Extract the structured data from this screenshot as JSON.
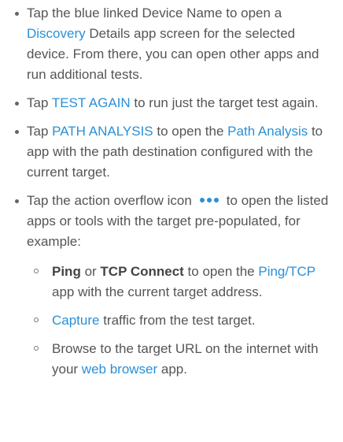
{
  "colors": {
    "link": "#2a8fd8",
    "text": "#555555"
  },
  "items": [
    {
      "pre": "Tap the blue linked Device Name to open a ",
      "link": "Discovery",
      "post": " Details app screen for the selected device. From there, you can open other apps and run additional tests."
    },
    {
      "pre": "Tap ",
      "link": "TEST AGAIN",
      "post": " to run just the target test again."
    },
    {
      "pre": "Tap ",
      "link": "PATH ANALYSIS",
      "mid": " to open the ",
      "link2": "Path Analysis",
      "post": " to app with the path destination configured with the current target."
    },
    {
      "pre": "Tap the action overflow icon",
      "icon": "overflow-dots-icon",
      "post": "to open the listed apps or tools with the target pre-populated, for example:"
    }
  ],
  "subitems": [
    {
      "bold1": "Ping",
      "or": " or ",
      "bold2": "TCP Connect",
      "mid": " to open the ",
      "link": "Ping/TCP",
      "post": " app with the current target address."
    },
    {
      "link": "Capture",
      "post": " traffic from the test target."
    },
    {
      "pre": "Browse to the target URL on the internet with your ",
      "link": "web browser",
      "post": " app."
    }
  ]
}
